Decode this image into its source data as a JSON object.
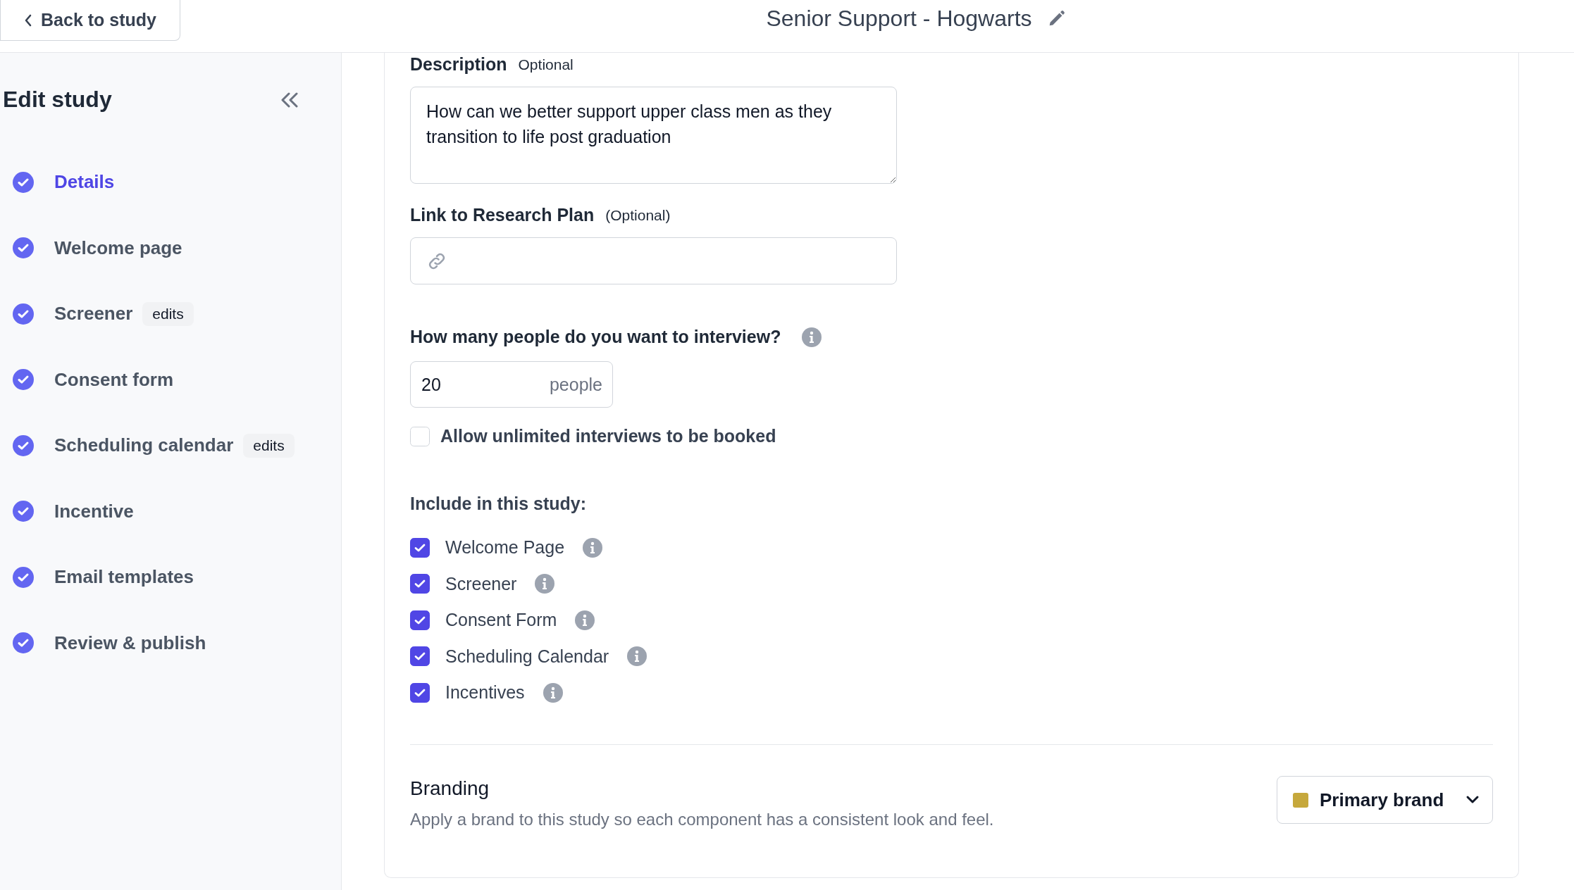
{
  "header": {
    "back_label": "Back to study",
    "title": "Senior Support - Hogwarts"
  },
  "sidebar": {
    "title": "Edit study",
    "items": [
      {
        "label": "Details",
        "selected": true,
        "done": true
      },
      {
        "label": "Welcome page",
        "selected": false,
        "done": true
      },
      {
        "label": "Screener",
        "selected": false,
        "done": true,
        "badge": "edits"
      },
      {
        "label": "Consent form",
        "selected": false,
        "done": true
      },
      {
        "label": "Scheduling calendar",
        "selected": false,
        "done": true,
        "badge": "edits"
      },
      {
        "label": "Incentive",
        "selected": false,
        "done": true
      },
      {
        "label": "Email templates",
        "selected": false,
        "done": true
      },
      {
        "label": "Review & publish",
        "selected": false,
        "done": true
      }
    ]
  },
  "description": {
    "label": "Description",
    "hint": "Optional",
    "value": "How can we better support upper class men as they transition to life post graduation"
  },
  "research_plan": {
    "label": "Link to Research Plan",
    "hint": "(Optional)"
  },
  "interviews": {
    "label": "How many people do you want to interview?",
    "value": "20",
    "unit": "people",
    "unlimited": {
      "label": "Allow unlimited interviews to be booked",
      "checked": false
    }
  },
  "include": {
    "label": "Include in this study:",
    "items": [
      {
        "label": "Welcome Page",
        "checked": true
      },
      {
        "label": "Screener",
        "checked": true
      },
      {
        "label": "Consent Form",
        "checked": true
      },
      {
        "label": "Scheduling Calendar",
        "checked": true
      },
      {
        "label": "Incentives",
        "checked": true
      }
    ]
  },
  "branding": {
    "title": "Branding",
    "text": "Apply a brand to this study so each component has a consistent look and feel.",
    "brand": {
      "label": "Primary brand",
      "color": "#c6a83c"
    }
  }
}
